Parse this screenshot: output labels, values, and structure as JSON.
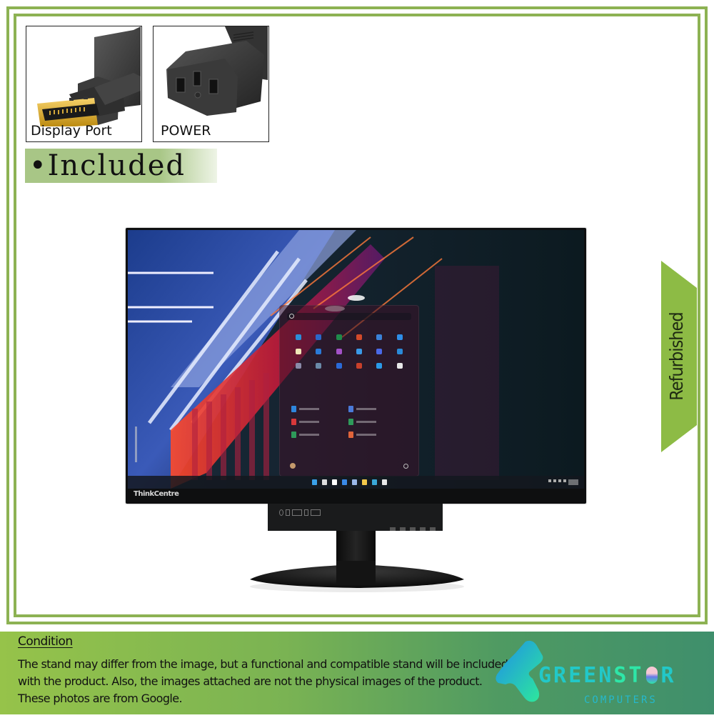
{
  "accessories": {
    "display_port": {
      "label": "Display Port",
      "icon": "displayport-connector-icon"
    },
    "power": {
      "label": "POWER",
      "icon": "power-cable-connector-icon"
    }
  },
  "included_label": "•Included",
  "ribbon_label": "Refurbished",
  "monitor": {
    "brand_logo": "ThinkCentre",
    "start_menu": {
      "pinned_tile_colors": [
        "#2b8ed8",
        "#2b67c8",
        "#1f8a4a",
        "#d24a2a",
        "#3a82d8",
        "#2e8ee8",
        "#f0e6b8",
        "#2a7ad8",
        "#a452c8",
        "#3a9ae8",
        "#4a6ae8",
        "#2a8ad8",
        "#8a8aa8",
        "#6a8aa8",
        "#2a6ad8",
        "#c8402a",
        "#2a9ae8",
        "#e8e8e8"
      ],
      "recommended_icon_colors": [
        "#2e86de",
        "#4a7ad8",
        "#d8383a",
        "#2e9a5a",
        "#2e9a5a",
        "#e0643a"
      ]
    },
    "taskbar_icon_colors": [
      "#3aa0e8",
      "#dddddd",
      "#ffffff",
      "#3a8ae8",
      "#9ab8e8",
      "#f2c84a",
      "#3aa8d8",
      "#e8e8e8"
    ]
  },
  "footer": {
    "condition_title": "Condition",
    "condition_text": "The stand may differ from the image, but a functional and compatible stand will be included with the product. Also, the images attached are not the physical images of the product. These photos are from Google.",
    "brand": {
      "name_part1": "GREEN",
      "name_part2": "ST",
      "name_part3": "R",
      "tagline": "COMPUTERS"
    }
  },
  "colors": {
    "frame_green": "#8db253",
    "included_band": "#a8c686",
    "ribbon_green": "#8dbb45",
    "footer_left": "#96c34a",
    "footer_right": "#3f8f6c",
    "logo_cyan": "#22c8c8",
    "logo_mint": "#2ee6a8"
  }
}
